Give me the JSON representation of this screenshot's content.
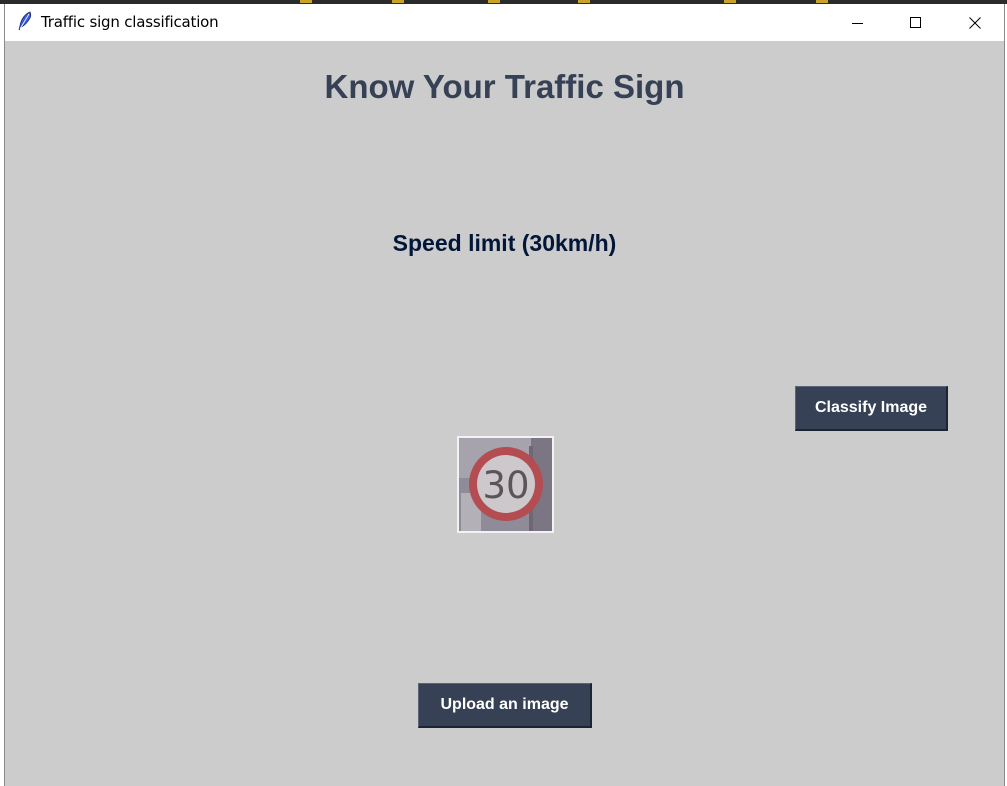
{
  "window": {
    "title": "Traffic sign classification",
    "icon": "feather-icon",
    "controls": [
      "minimize-icon",
      "maximize-icon",
      "close-icon"
    ]
  },
  "main": {
    "heading": "Know Your Traffic Sign",
    "result_label": "Speed limit (30km/h)",
    "uploaded_image": {
      "description_icon": "speed-limit-sign-image",
      "sign_text": "30"
    },
    "classify_button": "Classify Image",
    "upload_button": "Upload an image"
  },
  "colors": {
    "window_background": "#cccccc",
    "heading": "#364156",
    "result": "#011638",
    "button_background": "#364156",
    "button_text": "#ffffff"
  }
}
